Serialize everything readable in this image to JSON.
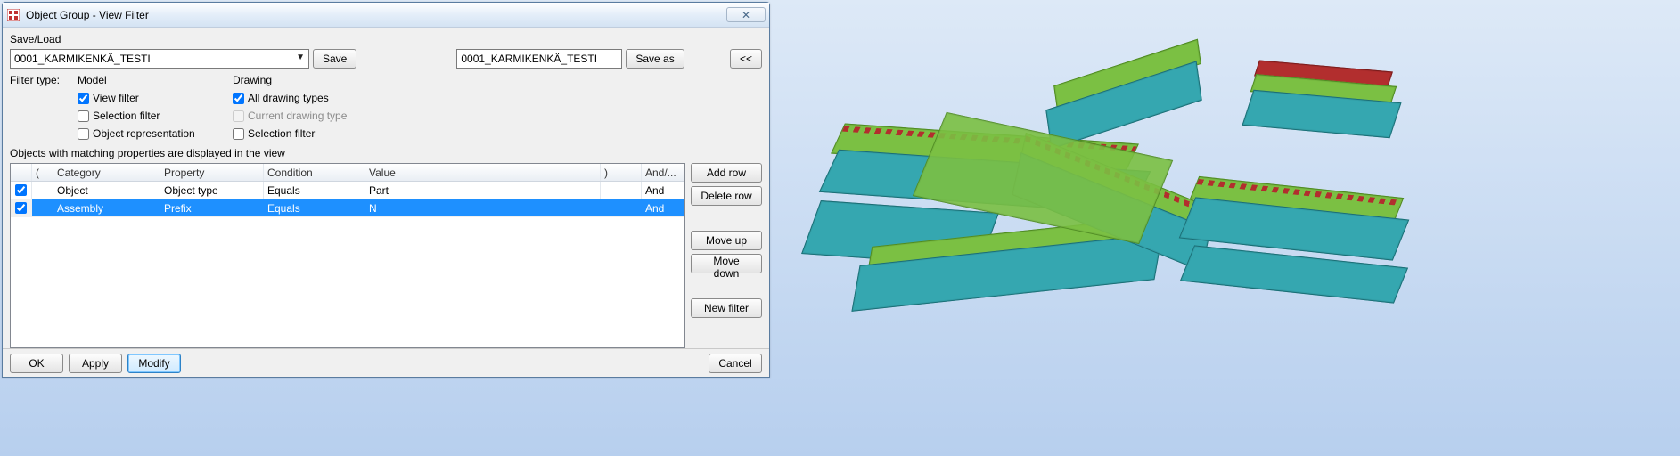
{
  "window": {
    "title": "Object Group - View Filter",
    "close_glyph": "✕"
  },
  "saveload": {
    "header": "Save/Load",
    "dropdown_value": "0001_KARMIKENKÄ_TESTI",
    "save_label": "Save",
    "display_value": "0001_KARMIKENKÄ_TESTI",
    "saveas_label": "Save as",
    "collapse_label": "<<"
  },
  "filter": {
    "typelabel": "Filter type:",
    "model_label": "Model",
    "drawing_label": "Drawing",
    "view_filter": {
      "label": "View filter",
      "checked": true
    },
    "selection_filter": {
      "label": "Selection filter",
      "checked": false
    },
    "object_repr": {
      "label": "Object representation",
      "checked": false
    },
    "all_drawing": {
      "label": "All drawing types",
      "checked": true
    },
    "current_drawing": {
      "label": "Current drawing type",
      "checked": false,
      "disabled": true
    },
    "drawing_selection": {
      "label": "Selection filter",
      "checked": false
    }
  },
  "grid": {
    "header_text": "Objects with matching properties are displayed in the view",
    "columns": {
      "paren_open": "(",
      "category": "Category",
      "property": "Property",
      "condition": "Condition",
      "value": "Value",
      "paren_close": ")",
      "andor": "And/..."
    },
    "rows": [
      {
        "checked": true,
        "category": "Object",
        "property": "Object type",
        "condition": "Equals",
        "value": "Part",
        "andor": "And",
        "selected": false
      },
      {
        "checked": true,
        "category": "Assembly",
        "property": "Prefix",
        "condition": "Equals",
        "value": "N",
        "andor": "And",
        "selected": true
      }
    ]
  },
  "sidebuttons": {
    "add_row": "Add row",
    "delete_row": "Delete row",
    "move_up": "Move up",
    "move_down": "Move down",
    "new_filter": "New filter"
  },
  "footer": {
    "ok": "OK",
    "apply": "Apply",
    "modify": "Modify",
    "cancel": "Cancel"
  }
}
